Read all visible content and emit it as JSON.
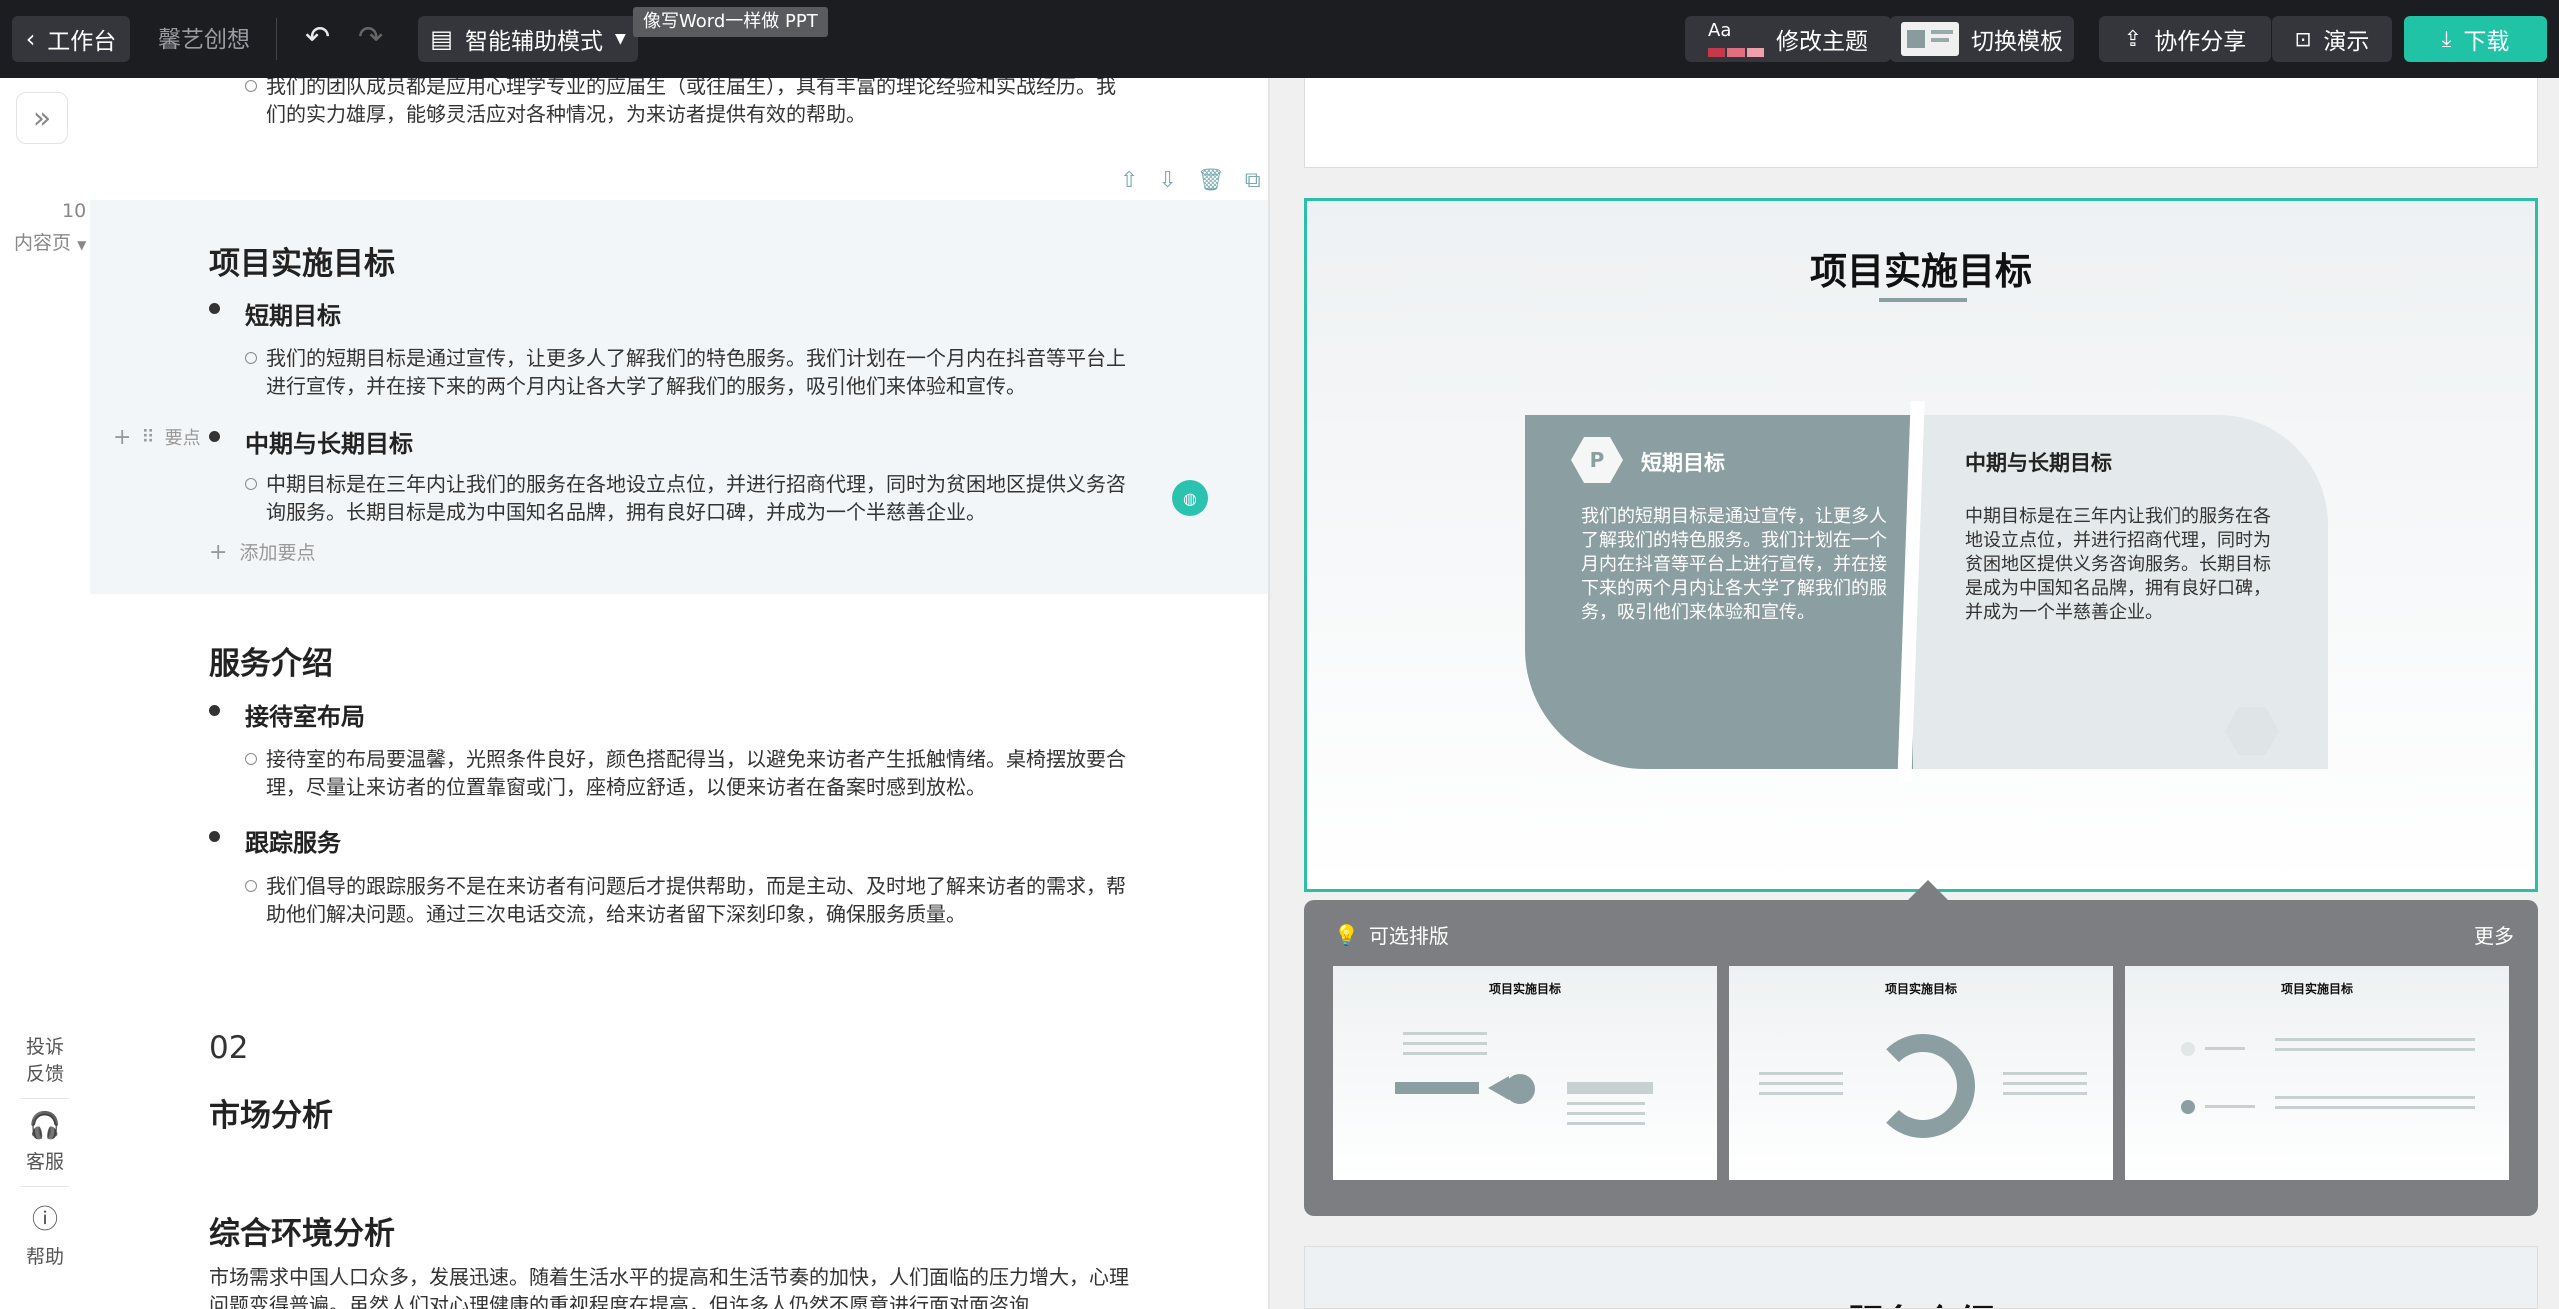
{
  "topbar": {
    "back_label": "工作台",
    "project_name": "馨艺创想",
    "mode_label": "智能辅助模式",
    "tooltip": "像写Word一样做 PPT",
    "theme_label": "修改主题",
    "theme_swatch_text": "Aa",
    "template_label": "切换模板",
    "share_label": "协作分享",
    "present_label": "演示",
    "download_label": "下载",
    "accent_color": "#20c3a6"
  },
  "editor": {
    "top_para": "我们的团队成员都是应用心理学专业的应届生（或往届生），具有丰富的理论经验和实战经历。我们的实力雄厚，能够灵活应对各种情况，为来访者提供有效的帮助。",
    "page_number": "10",
    "page_kind": "内容页",
    "section1": {
      "title": "项目实施目标",
      "p1_title": "短期目标",
      "p1_text": "我们的短期目标是通过宣传，让更多人了解我们的特色服务。我们计划在一个月内在抖音等平台上进行宣传，并在接下来的两个月内让各大学了解我们的服务，吸引他们来体验和宣传。",
      "p2_handle": "要点",
      "p2_title": "中期与长期目标",
      "p2_text": "中期目标是在三年内让我们的服务在各地设立点位，并进行招商代理，同时为贫困地区提供义务咨询服务。长期目标是成为中国知名品牌，拥有良好口碑，并成为一个半慈善企业。",
      "add_point": "添加要点"
    },
    "section2": {
      "title": "服务介绍",
      "p1_title": "接待室布局",
      "p1_text": "接待室的布局要温馨，光照条件良好，颜色搭配得当，以避免来访者产生抵触情绪。桌椅摆放要合理，尽量让来访者的位置靠窗或门，座椅应舒适，以便来访者在备案时感到放松。",
      "p2_title": "跟踪服务",
      "p2_text": "我们倡导的跟踪服务不是在来访者有问题后才提供帮助，而是主动、及时地了解来访者的需求，帮助他们解决问题。通过三次电话交流，给来访者留下深刻印象，确保服务质量。"
    },
    "chapter_number": "02",
    "chapter_title": "市场分析",
    "section3": {
      "title": "综合环境分析",
      "text": "市场需求中国人口众多，发展迅速。随着生活水平的提高和生活节奏的加快，人们面临的压力增大，心理问题变得普遍。虽然人们对心理健康的重视程度在提高，但许多人仍然不愿意进行面对面咨询"
    },
    "feedback": {
      "complaint": "投诉",
      "feedback": "反馈",
      "service": "客服",
      "help": "帮助"
    }
  },
  "preview": {
    "slide_title": "项目实施目标",
    "left_card_title": "短期目标",
    "left_card_text": "我们的短期目标是通过宣传，让更多人了解我们的特色服务。我们计划在一个月内在抖音等平台上进行宣传，并在接下来的两个月内让各大学了解我们的服务，吸引他们来体验和宣传。",
    "right_card_title": "中期与长期目标",
    "right_card_text": "中期目标是在三年内让我们的服务在各地设立点位，并进行招商代理，同时为贫困地区提供义务咨询服务。长期目标是成为中国知名品牌，拥有良好口碑，并成为一个半慈善企业。",
    "selected_border_color": "#2bbfa5",
    "card_color": "#8b9ea1",
    "layout_panel_title": "可选排版",
    "layout_more": "更多",
    "thumb_titles": [
      "项目实施目标",
      "项目实施目标",
      "项目实施目标"
    ],
    "next_slide_title": "服务介绍"
  }
}
